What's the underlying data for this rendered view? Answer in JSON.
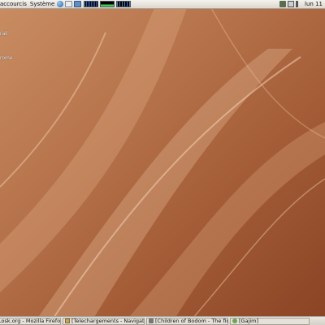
{
  "panel": {
    "menus": [
      {
        "label": "accourcis"
      },
      {
        "label": "Système"
      }
    ],
    "clock": "lun 11"
  },
  "desktop": {
    "icons": [
      {
        "label": "rail"
      },
      {
        "label": "rome"
      }
    ]
  },
  "taskbar": {
    "tasks": [
      {
        "label": "Losk.org - Mozilla Firefox]"
      },
      {
        "label": "[Telechargements - Navigateur de fi..."
      },
      {
        "label": "[Children of Bodom - The final coun..."
      },
      {
        "label": "[Gajim]"
      }
    ]
  },
  "colors": {
    "panel": "#dcd7cf",
    "wallpaper_dark": "#8a4324",
    "wallpaper_light": "#c98d62",
    "meter_green": "#3fd05a",
    "meter_blue": "#3f7fd0"
  }
}
